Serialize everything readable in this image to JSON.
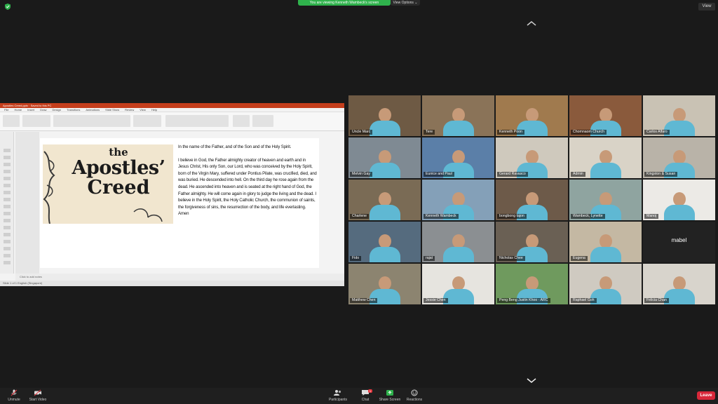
{
  "banner": {
    "viewing_text": "You are viewing Kenneth Wambeck's screen",
    "view_options_label": "View Options ⌄"
  },
  "top_right": {
    "view_label": "View"
  },
  "powerpoint": {
    "title_text": "Apostles Creed.pptx  ·  Saved to this PC",
    "tabs": [
      "File",
      "Home",
      "Insert",
      "Draw",
      "Design",
      "Transitions",
      "Animations",
      "Slide Show",
      "Review",
      "View",
      "Help"
    ],
    "notes_label": "Click to add notes",
    "status_text": "Slide 1 of 1    English (Singapore)"
  },
  "slide": {
    "art_the": "the",
    "art_apostles": "Apostles’",
    "art_creed": "Creed",
    "para1": "In the name of the Father, and of the Son and of the Holy Spirit.",
    "para2": "I believe in God, the Father almighty creator of heaven and earth and in Jesus Christ, His only Son, our Lord, who was conceived by the Holy Spirit, born of the Virgin Mary, suffered under Pontius Pilate, was crucified, died, and was buried. He descended into hell. On the third day he rose again from the dead. He ascended into heaven and is seated at the right hand of God, the Father almighty. He will come again in glory to judge the living and the dead. I believe in the Holy Spirit, the Holy Catholic Church, the communion of saints, the forgiveness of sins, the resurrection of the body, and life everlasting. Amen"
  },
  "participants": [
    {
      "name": "Uncle Marc"
    },
    {
      "name": "Tere"
    },
    {
      "name": "Kenneth Poon"
    },
    {
      "name": "Chomnaom Church"
    },
    {
      "name": "Carlos Alfaro"
    },
    {
      "name": "Melvin Gay"
    },
    {
      "name": "Eunice and Paul"
    },
    {
      "name": "Gerard Ravasco"
    },
    {
      "name": "Admin"
    },
    {
      "name": "Kingston & Susan"
    },
    {
      "name": "Charlene"
    },
    {
      "name": "Kenneth Wambeck"
    },
    {
      "name": "bongbong tajon"
    },
    {
      "name": "Wambeck, Lynette"
    },
    {
      "name": "Manoj"
    },
    {
      "name": "Fido"
    },
    {
      "name": "rajat"
    },
    {
      "name": "Nicholas Chee"
    },
    {
      "name": "Eugena"
    },
    {
      "name": "mabel"
    },
    {
      "name": "Matthew Chen"
    },
    {
      "name": "Jessie Chen"
    },
    {
      "name": "Peng Beng Justin Khoo - ARC"
    },
    {
      "name": "Raphael Goh"
    },
    {
      "name": "Felicia Chan"
    }
  ],
  "toolbar": {
    "unmute": "Unmute",
    "start_video": "Start Video",
    "participants": "Participants",
    "participants_count": "31",
    "chat": "Chat",
    "chat_badge": "1",
    "share_screen": "Share Screen",
    "reactions": "Reactions",
    "leave": "Leave"
  },
  "colors": {
    "banner_green": "#2fb24c",
    "active_speaker": "#e9d243",
    "leave_red": "#d8283a",
    "ppt_red": "#c43e1c",
    "shirt_blue": "#5fb8d3"
  }
}
